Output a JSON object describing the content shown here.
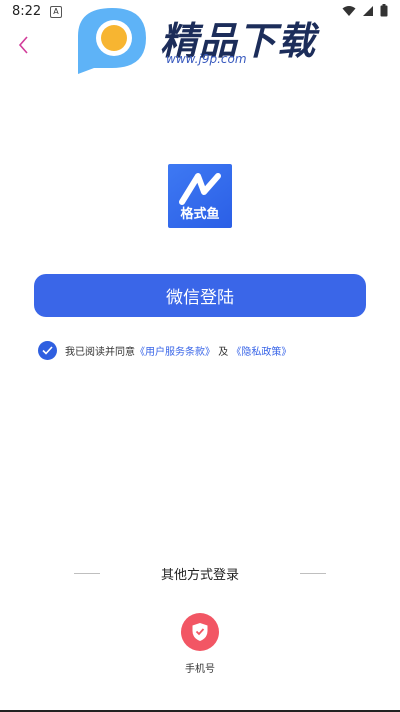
{
  "status": {
    "time": "8:22",
    "notif_letter": "A"
  },
  "watermark": {
    "title": "精品下载",
    "url": "www.j9p.com"
  },
  "app": {
    "name": "格式鱼",
    "brand_color": "#3a66e8"
  },
  "login": {
    "wechat_button": "微信登陆"
  },
  "agreement": {
    "prefix": "我已阅读并同意",
    "service_link": "《用户服务条款》",
    "conjunction": "及",
    "privacy_link": "《隐私政策》",
    "checked": true
  },
  "other_login": {
    "title": "其他方式登录",
    "phone_label": "手机号",
    "phone_color": "#f25664"
  },
  "icons": [
    "back-chevron-icon",
    "wifi-icon",
    "signal-icon",
    "battery-icon",
    "check-icon",
    "shield-check-icon"
  ]
}
